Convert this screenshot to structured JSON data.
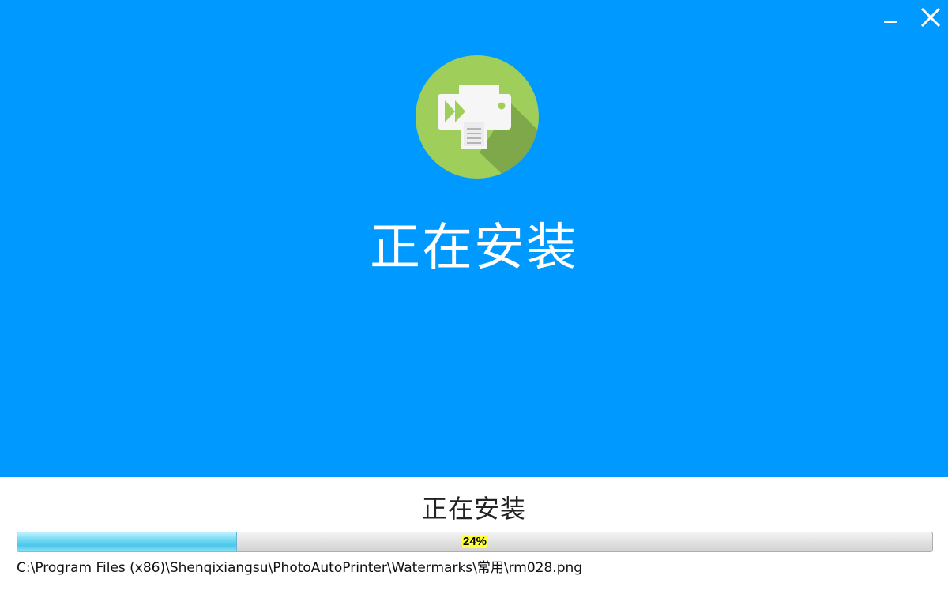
{
  "window": {
    "controls": {
      "minimize_icon": "minimize-icon",
      "close_icon": "close-icon"
    }
  },
  "hero": {
    "background_color": "#0099ff",
    "logo_icon": "printer-forward-icon",
    "logo_color": "#8cc63f",
    "title": "正在安装"
  },
  "install": {
    "status_title": "正在安装",
    "progress": {
      "percent": 24,
      "label": "24%"
    },
    "current_file": "C:\\Program Files (x86)\\Shenqixiangsu\\PhotoAutoPrinter\\Watermarks\\常用\\rm028.png"
  }
}
